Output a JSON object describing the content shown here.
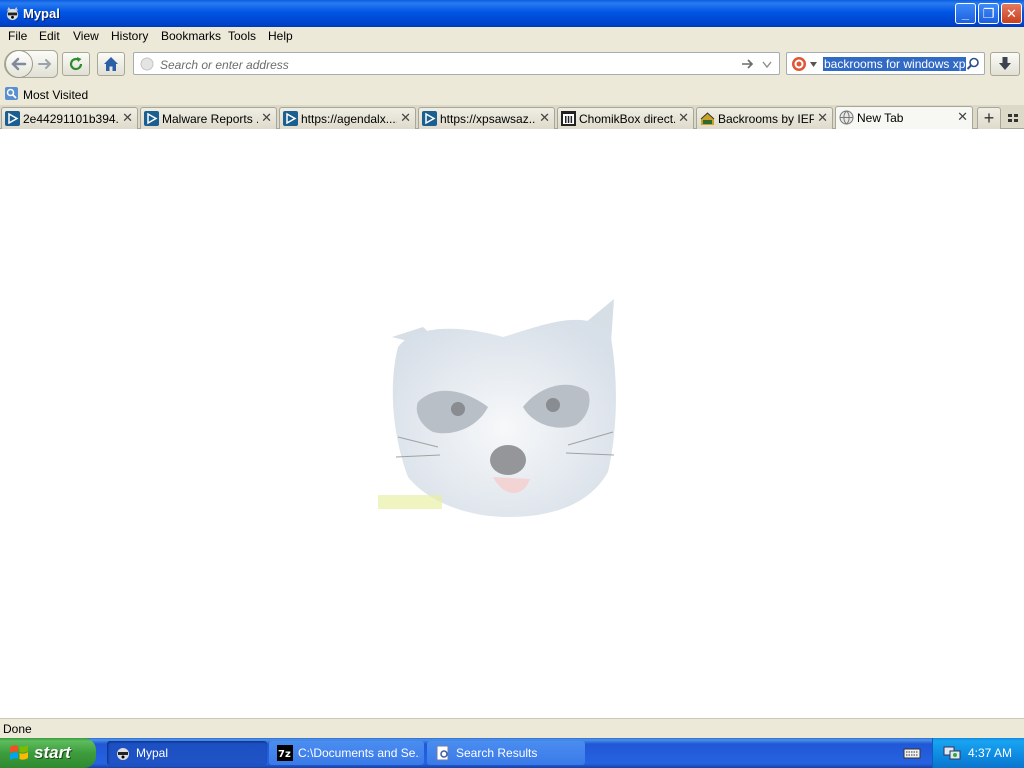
{
  "window": {
    "title": "Mypal",
    "minimize_glyph": "_",
    "restore_glyph": "❐",
    "close_glyph": "✕"
  },
  "menu": [
    "File",
    "Edit",
    "View",
    "History",
    "Bookmarks",
    "Tools",
    "Help"
  ],
  "navbar": {
    "address_placeholder": "Search or enter address",
    "search_query": "backrooms for windows xp"
  },
  "bookmarks": {
    "most_visited": "Most Visited"
  },
  "tabs": [
    {
      "label": "2e44291101b394...",
      "icon": "play-icon"
    },
    {
      "label": "Malware Reports ...",
      "icon": "play-icon"
    },
    {
      "label": "https://agendalx....",
      "icon": "play-icon"
    },
    {
      "label": "https://xpsawsaz...",
      "icon": "play-icon"
    },
    {
      "label": "ChomikBox direct...",
      "icon": "bank-icon"
    },
    {
      "label": "Backrooms by IEP...",
      "icon": "house-icon"
    },
    {
      "label": "New Tab",
      "icon": "globe-icon",
      "active": true
    }
  ],
  "tab_close_glyph": "✕",
  "new_tab_glyph": "+",
  "status": "Done",
  "taskbar": {
    "start": "start",
    "items": [
      {
        "label": "Mypal",
        "active": true
      },
      {
        "label": "C:\\Documents and Se..."
      },
      {
        "label": "Search Results"
      }
    ],
    "clock": "4:37 AM"
  },
  "colors": {
    "title_blue": "#0055e5",
    "taskbar_blue": "#2663e0",
    "start_green": "#3d9c3d",
    "selection_blue": "#316ac5"
  }
}
